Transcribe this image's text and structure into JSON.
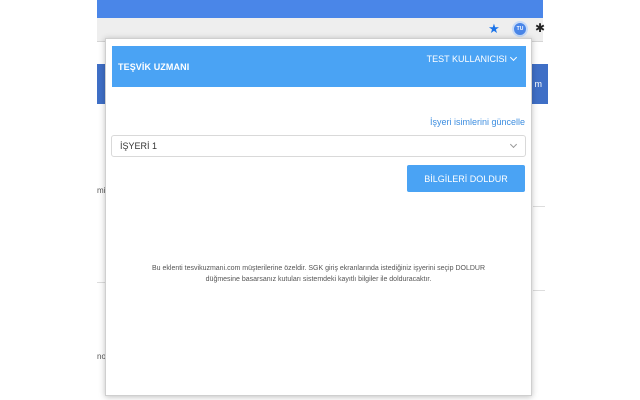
{
  "browser": {
    "extension_icon_text": "TU",
    "background_snippets": [
      "r m",
      "mi",
      "no"
    ]
  },
  "popup": {
    "brand": "TEŞVİK UZMANI",
    "user_name": "TEST KULLANICISI",
    "update_link": "İşyeri isimlerini güncelle",
    "workplace_select": {
      "selected": "İŞYERİ 1"
    },
    "fill_button": "BİLGİLERİ DOLDUR",
    "description_line1": "Bu eklenti tesvikuzmani.com müşterilerine özeldir. SGK giriş ekranlarında istediğiniz işyerini seçip DOLDUR",
    "description_line2": "düğmesine basarsanız kutuları sistemdeki kayıtlı bilgiler ile dolduracaktır."
  },
  "colors": {
    "header": "#4aa3f4",
    "link": "#3d8ee0",
    "browser_blue": "#4a86e8"
  }
}
